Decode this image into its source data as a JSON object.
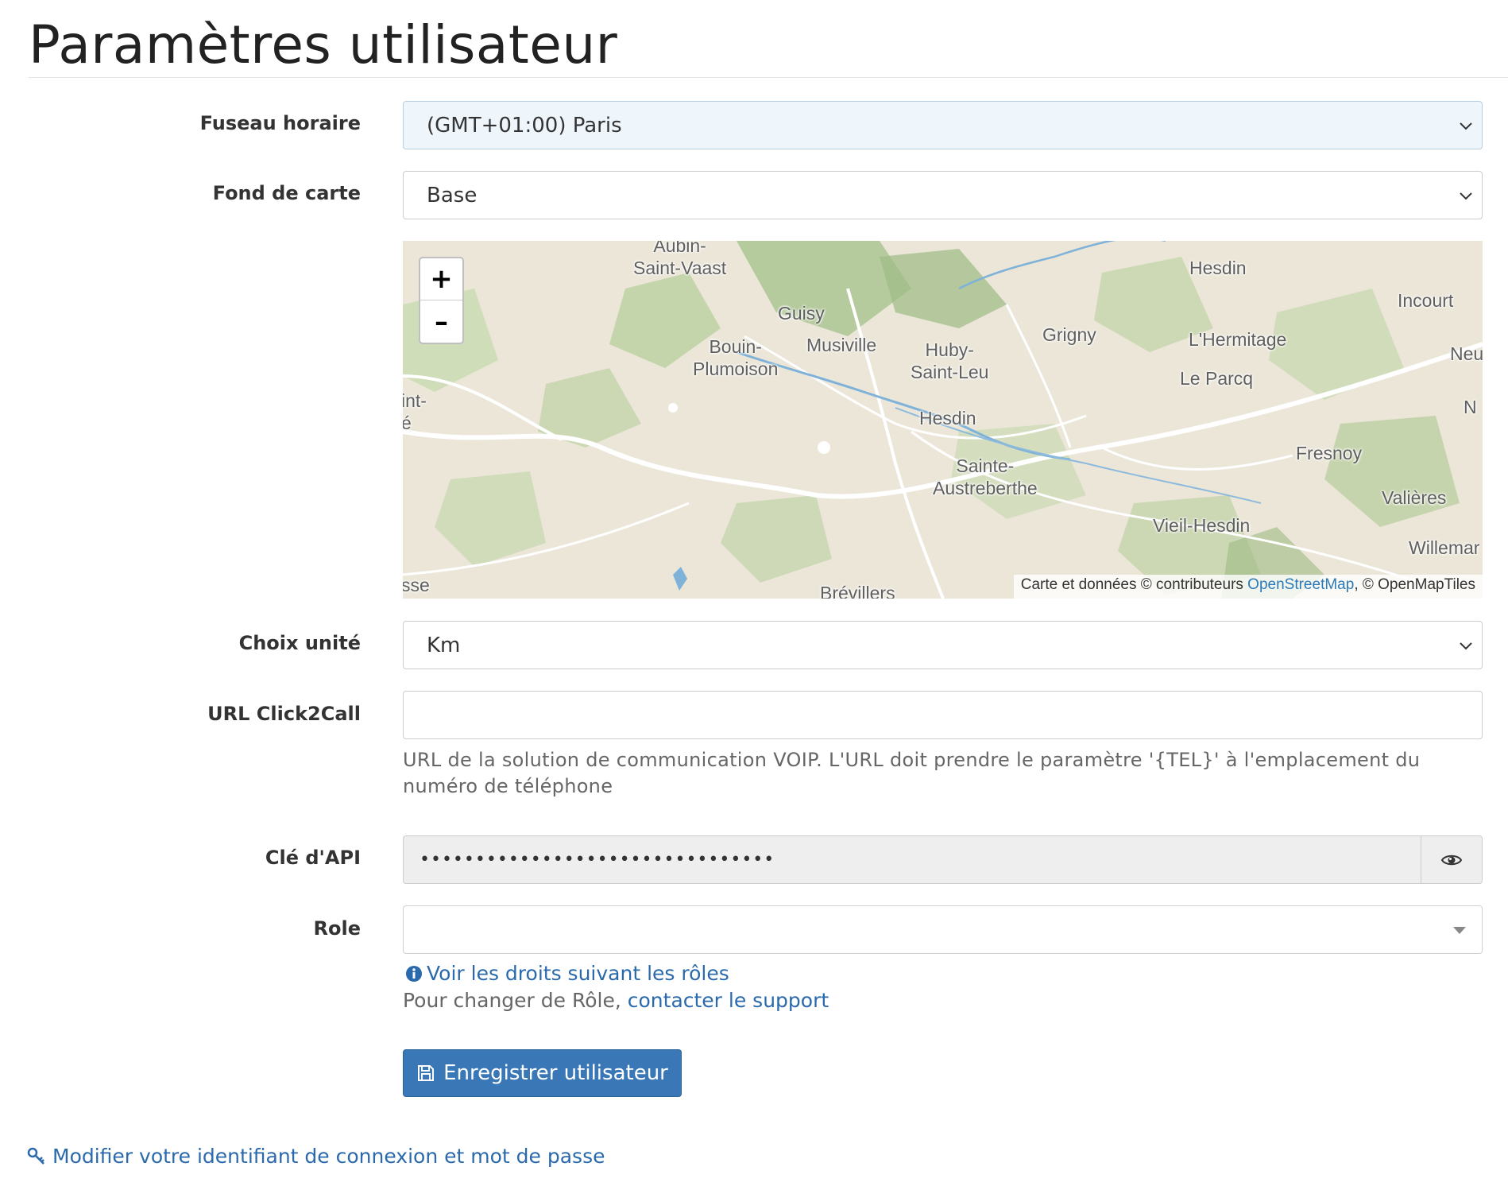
{
  "page": {
    "title": "Paramètres utilisateur"
  },
  "timezone": {
    "label": "Fuseau horaire",
    "value": "(GMT+01:00) Paris"
  },
  "basemap": {
    "label": "Fond de carte",
    "value": "Base"
  },
  "map": {
    "zoom_in": "+",
    "zoom_out": "–",
    "places": [
      "Aubin-",
      "Saint-Vaast",
      "Aubin-Saint-Vaast",
      "Hesdin",
      "Guisy",
      "Incourt",
      "Bouin-",
      "Plumoison",
      "Musiville",
      "Huby-",
      "Saint-Leu",
      "Grigny",
      "L'Hermitage",
      "Neu",
      "Le Parcq",
      "int-",
      "é",
      "N",
      "Hesdin",
      "Fresnoy",
      "Sainte-",
      "Austreberthe",
      "Valières",
      "Vieil-Hesdin",
      "Willemar",
      "sse",
      "Brévillers"
    ],
    "attribution": {
      "prefix": "Carte et données © contributeurs ",
      "osm": "OpenStreetMap",
      "suffix": ", © OpenMapTiles"
    }
  },
  "unit": {
    "label": "Choix unité",
    "value": "Km"
  },
  "click2call": {
    "label": "URL Click2Call",
    "value": "",
    "help": "URL de la solution de communication VOIP. L'URL doit prendre le paramètre '{TEL}' à l'emplacement du numéro de téléphone"
  },
  "api": {
    "label": "Clé d'API",
    "masked_value": "••••••••••••••••••••••••••••••••"
  },
  "role": {
    "label": "Role",
    "value": "",
    "rights_link": "Voir les droits suivant les rôles",
    "change_text": "Pour changer de Rôle, ",
    "support_link": "contacter le support"
  },
  "actions": {
    "save": "Enregistrer utilisateur"
  },
  "footer": {
    "credentials_link": "Modifier votre identifiant de connexion et mot de passe"
  },
  "icons": {
    "chevron": "chevron-down-icon",
    "caret": "caret-down-icon",
    "eye": "eye-icon",
    "info": "info-circle-icon",
    "save": "floppy-disk-icon",
    "key": "key-icon"
  },
  "colors": {
    "primary": "#3a77b7",
    "link": "#2a6aac",
    "timezone_bg": "#eef6fc"
  }
}
